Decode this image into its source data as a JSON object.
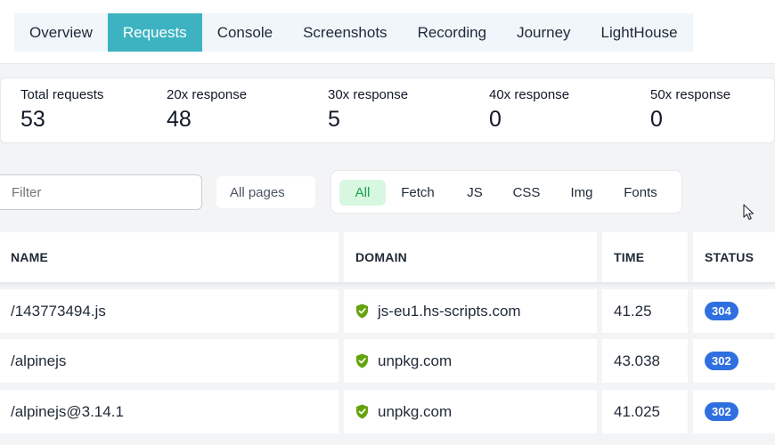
{
  "tabs": [
    {
      "label": "Overview",
      "active": false
    },
    {
      "label": "Requests",
      "active": true
    },
    {
      "label": "Console",
      "active": false
    },
    {
      "label": "Screenshots",
      "active": false
    },
    {
      "label": "Recording",
      "active": false
    },
    {
      "label": "Journey",
      "active": false
    },
    {
      "label": "LightHouse",
      "active": false
    }
  ],
  "stats": [
    {
      "label": "Total requests",
      "value": "53"
    },
    {
      "label": "20x response",
      "value": "48"
    },
    {
      "label": "30x response",
      "value": "5"
    },
    {
      "label": "40x response",
      "value": "0"
    },
    {
      "label": "50x response",
      "value": "0"
    }
  ],
  "filter": {
    "placeholder": "Filter",
    "pages_value": "All pages"
  },
  "types": [
    {
      "label": "All",
      "active": true
    },
    {
      "label": "Fetch",
      "active": false
    },
    {
      "label": "JS",
      "active": false
    },
    {
      "label": "CSS",
      "active": false
    },
    {
      "label": "Img",
      "active": false
    },
    {
      "label": "Fonts",
      "active": false
    }
  ],
  "table": {
    "headers": {
      "name": "NAME",
      "domain": "DOMAIN",
      "time": "TIME",
      "status": "STATUS"
    },
    "rows": [
      {
        "name": "/143773494.js",
        "domain": "js-eu1.hs-scripts.com",
        "time": "41.25",
        "status": "304"
      },
      {
        "name": "/alpinejs",
        "domain": "unpkg.com",
        "time": "43.038",
        "status": "302"
      },
      {
        "name": "/alpinejs@3.14.1",
        "domain": "unpkg.com",
        "time": "41.025",
        "status": "302"
      }
    ]
  },
  "colors": {
    "accent": "#3db3c1",
    "status_badge": "#2f6fe0",
    "shield": "#65a30d",
    "active_type_bg": "#d7f7e1"
  },
  "icons": {
    "secure": "shield-check-icon",
    "cursor": "mouse-pointer-icon"
  }
}
